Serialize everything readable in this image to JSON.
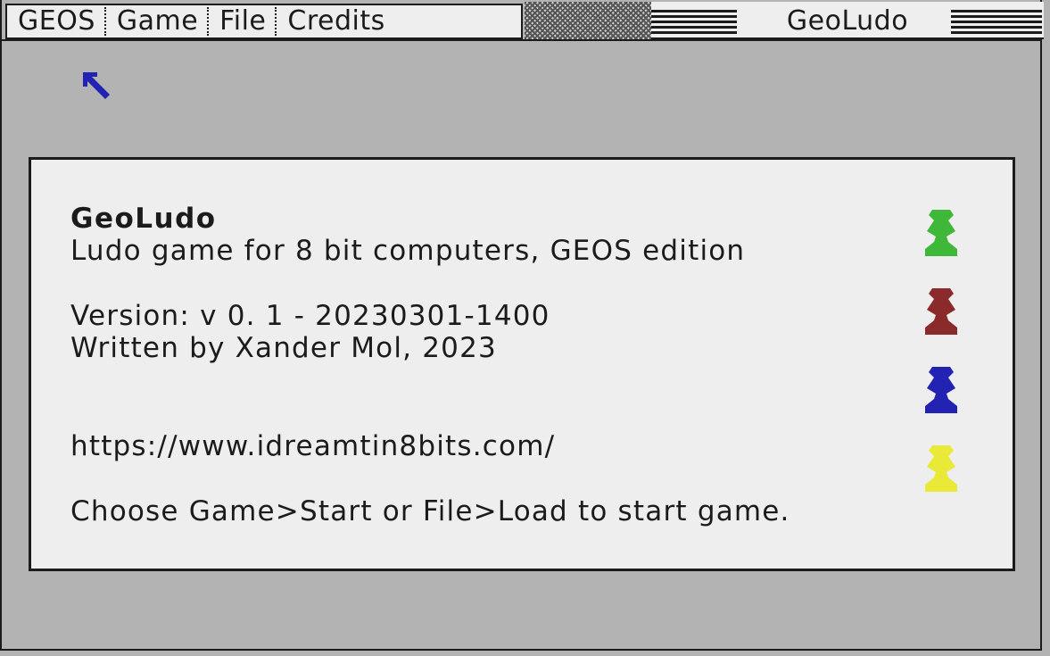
{
  "menubar": {
    "items": [
      {
        "label": "GEOS"
      },
      {
        "label": "Game"
      },
      {
        "label": "File"
      },
      {
        "label": "Credits"
      }
    ]
  },
  "window": {
    "title": "GeoLudo"
  },
  "info": {
    "app_name": "GeoLudo",
    "tagline": "Ludo game for 8 bit computers, GEOS edition",
    "version": "Version: v 0. 1 - 20230301-1400",
    "author": "Written by Xander Mol, 2023",
    "url": "https://www.idreamtin8bits.com/",
    "instruction": "Choose Game>Start or File>Load to start game."
  },
  "pawns": [
    {
      "color": "#3fb83a",
      "icon": "green-pawn-icon"
    },
    {
      "color": "#8a2a2a",
      "icon": "red-pawn-icon"
    },
    {
      "color": "#2323b3",
      "icon": "blue-pawn-icon"
    },
    {
      "color": "#e9e938",
      "icon": "yellow-pawn-icon"
    }
  ],
  "colors": {
    "background": "#b3b3b3",
    "panel": "#eeeeee",
    "ink": "#1b1b1b",
    "pointer": "#2323b3"
  }
}
